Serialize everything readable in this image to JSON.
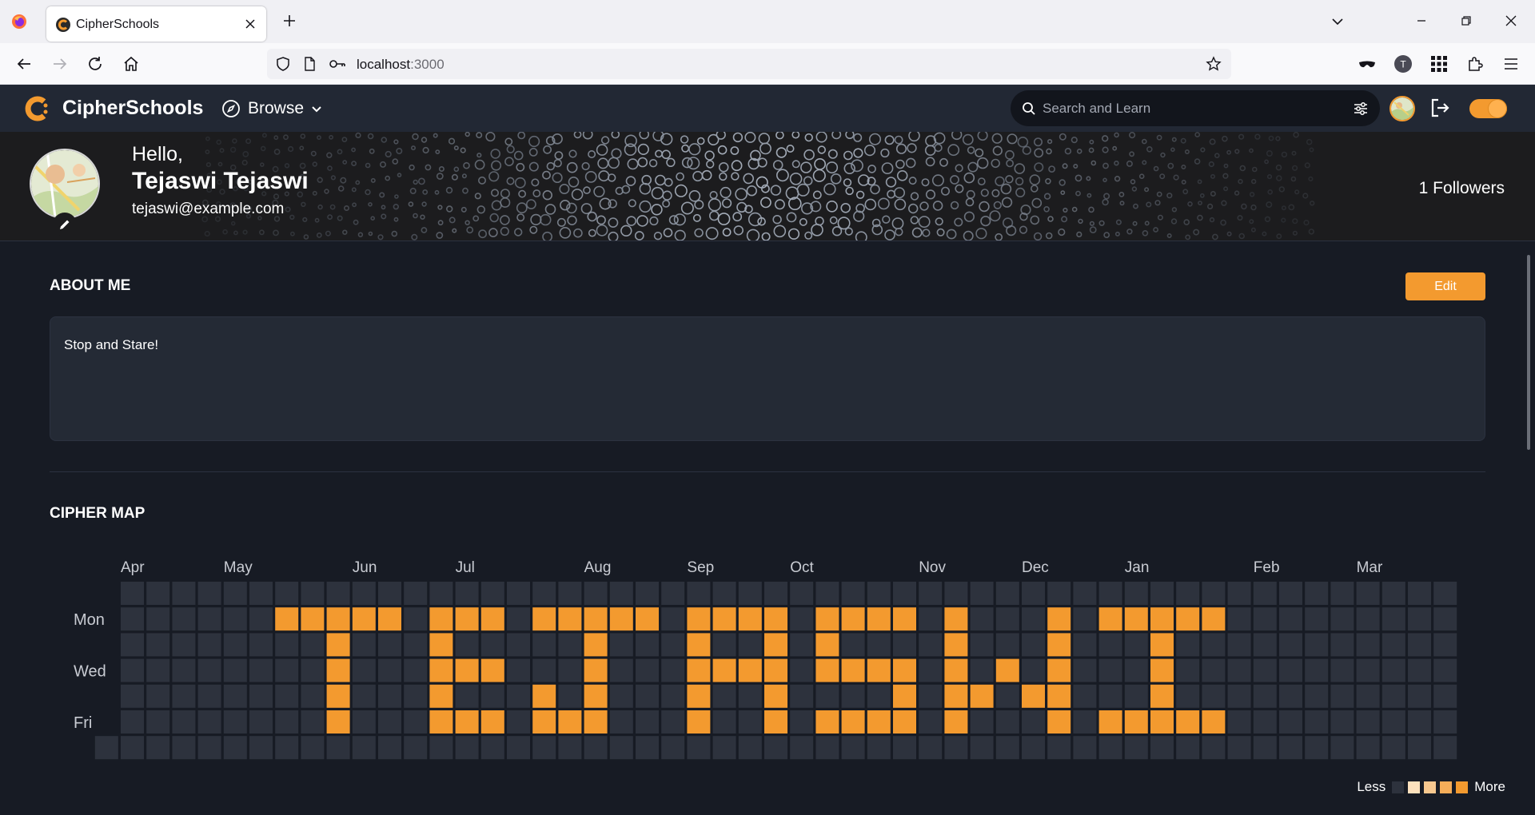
{
  "browser": {
    "tab_title": "CipherSchools",
    "url_host": "localhost",
    "url_port": ":3000"
  },
  "site": {
    "name": "CipherSchools",
    "browse_label": "Browse",
    "search_placeholder": "Search and Learn"
  },
  "profile": {
    "greeting": "Hello,",
    "name": "Tejaswi Tejaswi",
    "email": "tejaswi@example.com",
    "followers": "1 Followers"
  },
  "about": {
    "title": "ABOUT ME",
    "edit_label": "Edit",
    "text": "Stop and Stare!"
  },
  "cipher_map": {
    "title": "CIPHER MAP",
    "months": [
      "Apr",
      "May",
      "Jun",
      "Jul",
      "Aug",
      "Sep",
      "Oct",
      "Nov",
      "Dec",
      "Jan",
      "Feb",
      "Mar"
    ],
    "month_week_index": [
      0,
      4,
      9,
      13,
      18,
      22,
      26,
      31,
      35,
      39,
      44,
      48
    ],
    "weekday_labels": [
      "",
      "Mon",
      "",
      "Wed",
      "",
      "Fri",
      ""
    ],
    "weeks": 53,
    "first_week_start_row": 6,
    "active_level": 4,
    "active_cells": [
      [
        7,
        1
      ],
      [
        8,
        1
      ],
      [
        9,
        1
      ],
      [
        10,
        1
      ],
      [
        11,
        1
      ],
      [
        9,
        2
      ],
      [
        9,
        3
      ],
      [
        9,
        4
      ],
      [
        9,
        5
      ],
      [
        13,
        1
      ],
      [
        14,
        1
      ],
      [
        15,
        1
      ],
      [
        13,
        2
      ],
      [
        13,
        3
      ],
      [
        14,
        3
      ],
      [
        15,
        3
      ],
      [
        13,
        4
      ],
      [
        13,
        5
      ],
      [
        14,
        5
      ],
      [
        15,
        5
      ],
      [
        17,
        1
      ],
      [
        18,
        1
      ],
      [
        19,
        1
      ],
      [
        20,
        1
      ],
      [
        21,
        1
      ],
      [
        19,
        2
      ],
      [
        19,
        3
      ],
      [
        17,
        4
      ],
      [
        19,
        4
      ],
      [
        17,
        5
      ],
      [
        18,
        5
      ],
      [
        19,
        5
      ],
      [
        23,
        1
      ],
      [
        24,
        1
      ],
      [
        25,
        1
      ],
      [
        26,
        1
      ],
      [
        23,
        2
      ],
      [
        26,
        2
      ],
      [
        23,
        3
      ],
      [
        24,
        3
      ],
      [
        25,
        3
      ],
      [
        26,
        3
      ],
      [
        23,
        4
      ],
      [
        26,
        4
      ],
      [
        23,
        5
      ],
      [
        26,
        5
      ],
      [
        28,
        1
      ],
      [
        29,
        1
      ],
      [
        30,
        1
      ],
      [
        31,
        1
      ],
      [
        28,
        2
      ],
      [
        28,
        3
      ],
      [
        29,
        3
      ],
      [
        30,
        3
      ],
      [
        31,
        3
      ],
      [
        31,
        4
      ],
      [
        28,
        5
      ],
      [
        29,
        5
      ],
      [
        30,
        5
      ],
      [
        31,
        5
      ],
      [
        33,
        1
      ],
      [
        37,
        1
      ],
      [
        33,
        2
      ],
      [
        37,
        2
      ],
      [
        33,
        3
      ],
      [
        35,
        3
      ],
      [
        37,
        3
      ],
      [
        33,
        4
      ],
      [
        34,
        4
      ],
      [
        36,
        4
      ],
      [
        37,
        4
      ],
      [
        33,
        5
      ],
      [
        37,
        5
      ],
      [
        39,
        1
      ],
      [
        40,
        1
      ],
      [
        41,
        1
      ],
      [
        42,
        1
      ],
      [
        43,
        1
      ],
      [
        41,
        2
      ],
      [
        41,
        3
      ],
      [
        41,
        4
      ],
      [
        39,
        5
      ],
      [
        40,
        5
      ],
      [
        41,
        5
      ],
      [
        42,
        5
      ],
      [
        43,
        5
      ]
    ],
    "colors": {
      "empty": "#2d323d",
      "level1": "#fde1bd",
      "level2": "#f7c88f",
      "level3": "#f5ad59",
      "level4": "#f39a2f"
    },
    "legend_less": "Less",
    "legend_more": "More"
  },
  "colors": {
    "accent": "#f39a2f",
    "background": "#171b24",
    "header": "#222834",
    "card": "#242a35"
  }
}
